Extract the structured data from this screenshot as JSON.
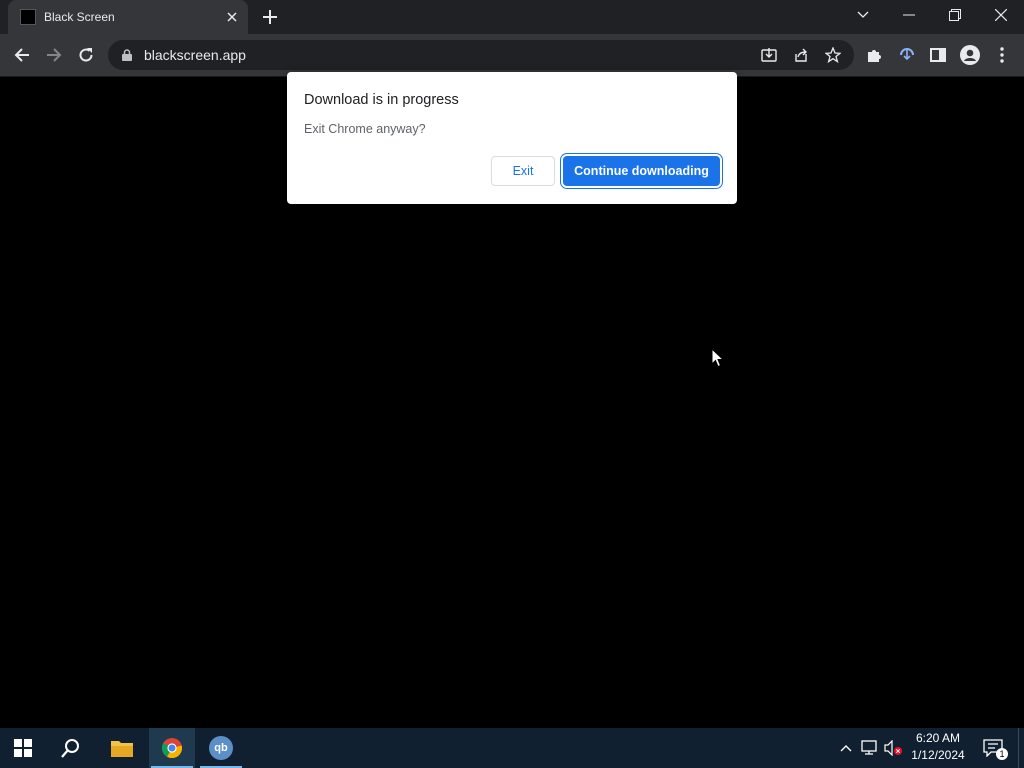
{
  "browser": {
    "tab": {
      "title": "Black Screen"
    },
    "address": {
      "url": "blackscreen.app"
    }
  },
  "dialog": {
    "title": "Download is in progress",
    "message": "Exit Chrome anyway?",
    "exit_label": "Exit",
    "continue_label": "Continue downloading"
  },
  "taskbar": {
    "time": "6:20 AM",
    "date": "1/12/2024",
    "qb_label": "qb",
    "notification_count": "1"
  },
  "colors": {
    "accent": "#1a73e8",
    "page_background": "#000000",
    "toolbar": "#35363a",
    "tabstrip": "#202124"
  }
}
